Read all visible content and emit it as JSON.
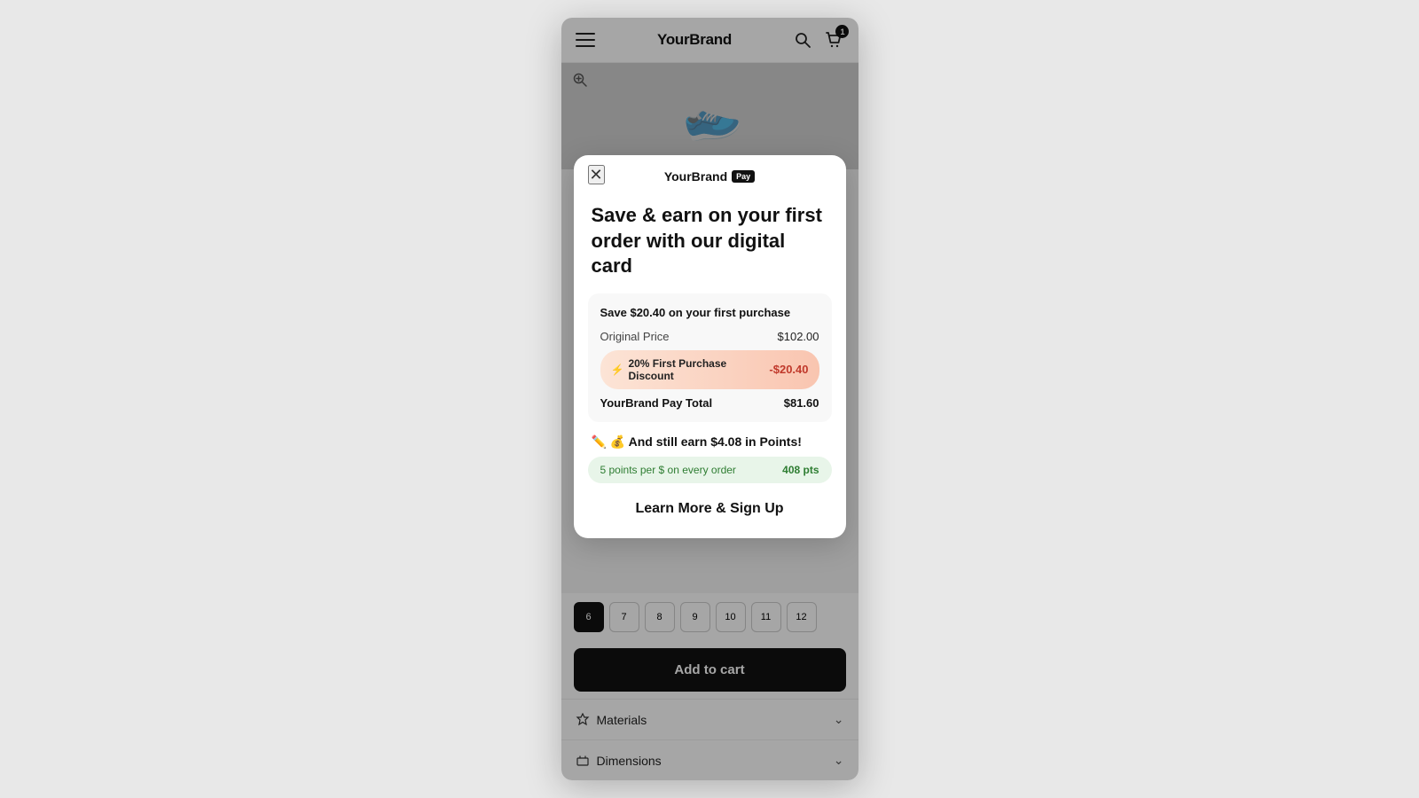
{
  "brand": {
    "name": "YourBrand",
    "pay_label": "Pay"
  },
  "nav": {
    "cart_count": "1"
  },
  "modal": {
    "title": "Save & earn on your first order with our digital card",
    "savings_header": "Save $20.40 on your first purchase",
    "original_price_label": "Original Price",
    "original_price_value": "$102.00",
    "discount_label": "20% First Purchase Discount",
    "discount_value": "-$20.40",
    "total_label": "YourBrand Pay Total",
    "total_value": "$81.60",
    "earn_text": "✏️ 💰 And still earn $4.08 in Points!",
    "points_per_dollar": "5 points per $ on every order",
    "points_earned": "408 pts",
    "cta_label": "Learn More & Sign Up"
  },
  "product": {
    "add_to_cart": "Add to cart"
  },
  "accordion": {
    "materials_label": "Materials",
    "dimensions_label": "Dimensions"
  },
  "sizes": [
    "6",
    "7",
    "8",
    "9",
    "10",
    "11",
    "12"
  ],
  "size_selected_index": 0
}
